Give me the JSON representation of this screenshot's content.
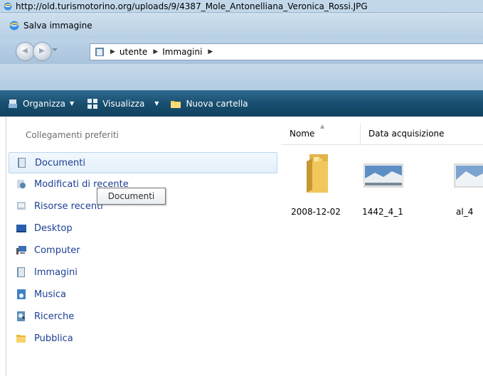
{
  "browser_title": "http://old.turismotorino.org/uploads/9/4387_Mole_Antonelliana_Veronica_Rossi.JPG",
  "dialog_title": "Salva immagine",
  "breadcrumb": {
    "items": [
      "utente",
      "Immagini"
    ]
  },
  "toolbar": {
    "organize_label": "Organizza",
    "view_label": "Visualizza",
    "new_folder_label": "Nuova cartella"
  },
  "sidebar": {
    "header": "Collegamenti preferiti",
    "items": [
      {
        "label": "Documenti",
        "icon": "documents-icon"
      },
      {
        "label": "Modificati di recente",
        "icon": "recent-changes-icon"
      },
      {
        "label": "Risorse recenti",
        "icon": "recent-places-icon"
      },
      {
        "label": "Desktop",
        "icon": "desktop-icon"
      },
      {
        "label": "Computer",
        "icon": "computer-icon"
      },
      {
        "label": "Immagini",
        "icon": "pictures-icon"
      },
      {
        "label": "Musica",
        "icon": "music-icon"
      },
      {
        "label": "Ricerche",
        "icon": "searches-icon"
      },
      {
        "label": "Pubblica",
        "icon": "public-folder-icon"
      }
    ],
    "selected_index": 0
  },
  "tooltip": "Documenti",
  "columns": {
    "name": "Nome",
    "date": "Data acquisizione"
  },
  "files": [
    {
      "name": "2008-12-02",
      "type": "folder"
    },
    {
      "name": "1442_4_1",
      "type": "image"
    },
    {
      "name": "al_4",
      "type": "image"
    }
  ],
  "colors": {
    "toolbar_bg": "#174d6e",
    "link_text": "#1c3f94",
    "selection_bg": "#e3effa"
  }
}
